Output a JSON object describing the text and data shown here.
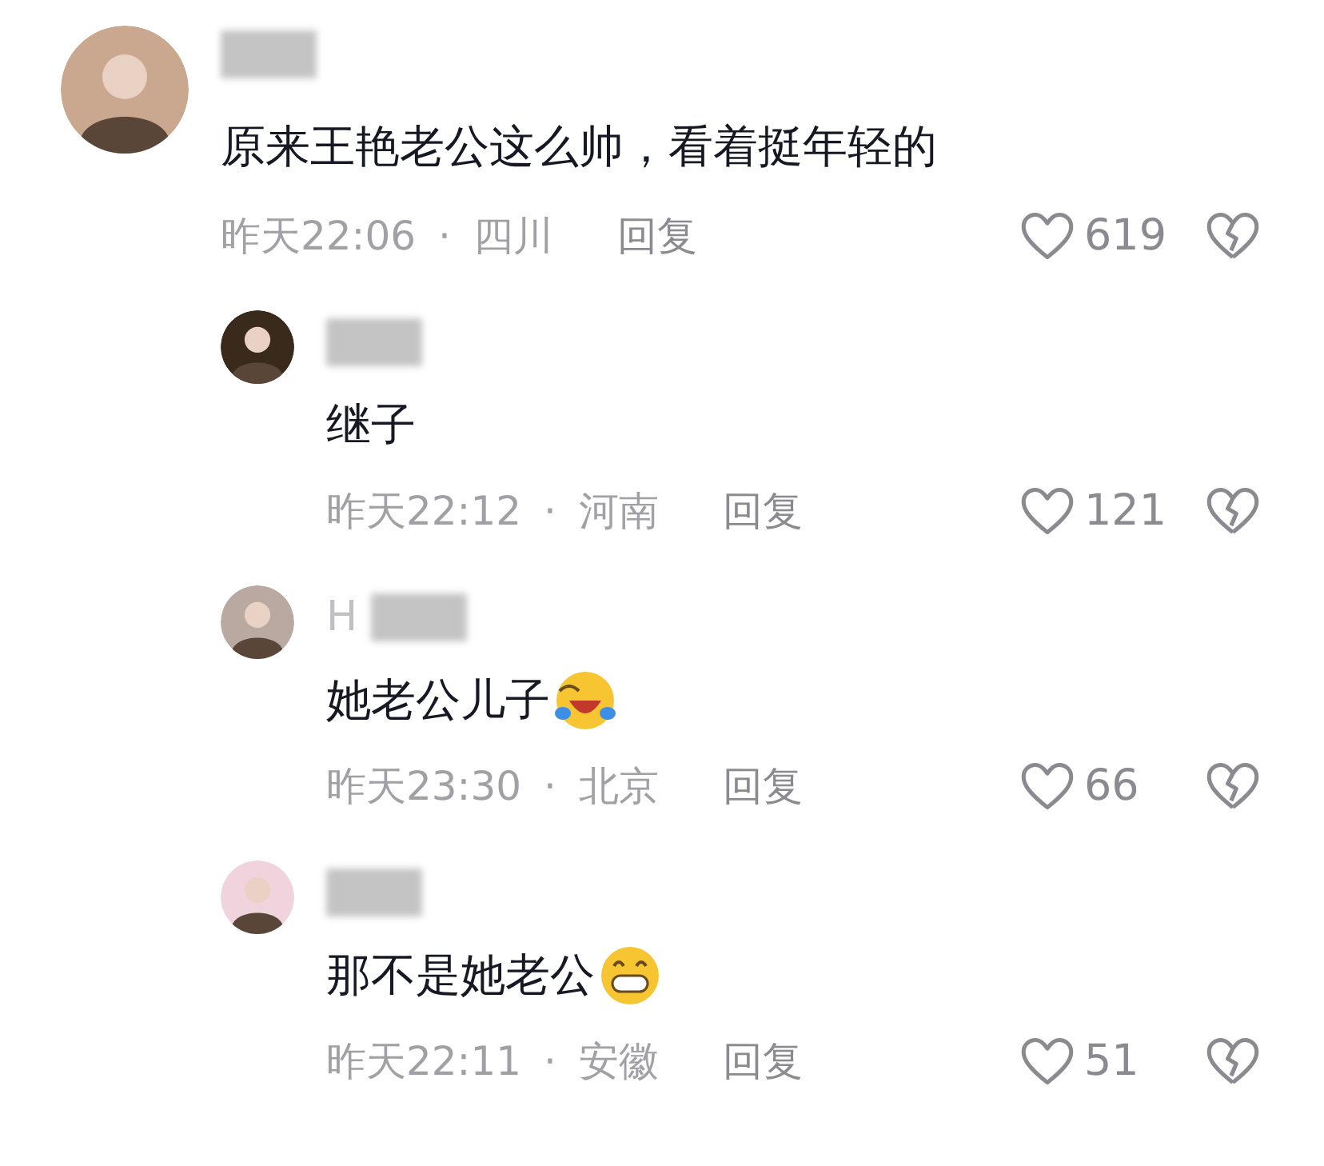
{
  "comment": {
    "text": "原来王艳老公这么帅，看着挺年轻的",
    "time": "昨天22:06",
    "separator": "·",
    "location": "四川",
    "reply": "回复",
    "likes": "619",
    "replies": [
      {
        "text": "继子",
        "time": "昨天22:12",
        "separator": "·",
        "location": "河南",
        "reply": "回复",
        "likes": "121"
      },
      {
        "username": "H",
        "text": "她老公儿子",
        "emoji": {
          "kind": "laughing-crying"
        },
        "time": "昨天23:30",
        "separator": "·",
        "location": "北京",
        "reply": "回复",
        "likes": "66"
      },
      {
        "text": "那不是她老公",
        "emoji": {
          "kind": "grin"
        },
        "time": "昨天22:11",
        "separator": "·",
        "location": "安徽",
        "reply": "回复",
        "likes": "51"
      }
    ]
  }
}
